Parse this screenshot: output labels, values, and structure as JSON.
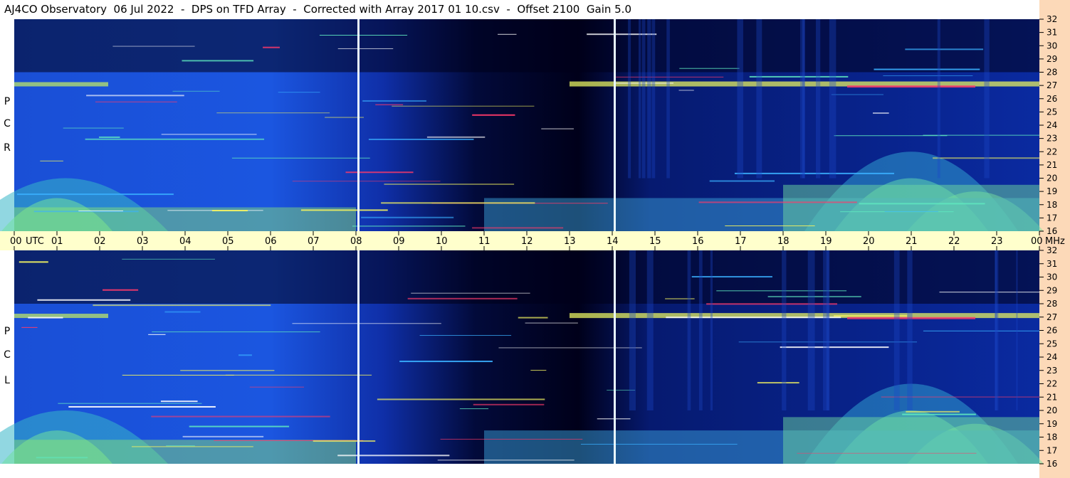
{
  "title": "AJ4CO Observatory  06 Jul 2022  -  DPS on TFD Array  -  Corrected with Array 2017 01 10.csv  -  Offset 2100  Gain 5.0",
  "chart_data": {
    "type": "heatmap",
    "x_axis": {
      "unit_label": "UTC",
      "ticks": [
        "00",
        "01",
        "02",
        "03",
        "04",
        "05",
        "06",
        "07",
        "08",
        "09",
        "10",
        "11",
        "12",
        "13",
        "14",
        "15",
        "16",
        "17",
        "18",
        "19",
        "20",
        "21",
        "22",
        "23",
        "00"
      ],
      "range_hours": [
        0,
        24
      ]
    },
    "y_axis": {
      "unit_label": "MHz",
      "ticks": [
        "16",
        "17",
        "18",
        "19",
        "20",
        "21",
        "22",
        "23",
        "24",
        "25",
        "26",
        "27",
        "28",
        "29",
        "30",
        "31",
        "32"
      ],
      "range_mhz": [
        16,
        32
      ]
    },
    "panels": [
      {
        "label_letters": [
          "R",
          "C",
          "P"
        ]
      },
      {
        "label_letters": [
          "L",
          "C",
          "P"
        ]
      }
    ],
    "markers_utc_hours": [
      8.05,
      14.05
    ],
    "colors": {
      "background_dark": "#00001a",
      "mid_blue": "#1a4fd6",
      "bright": "#5fd8a0",
      "hot": "#ff3a6a",
      "marker_line": "#e8f8ff"
    }
  }
}
